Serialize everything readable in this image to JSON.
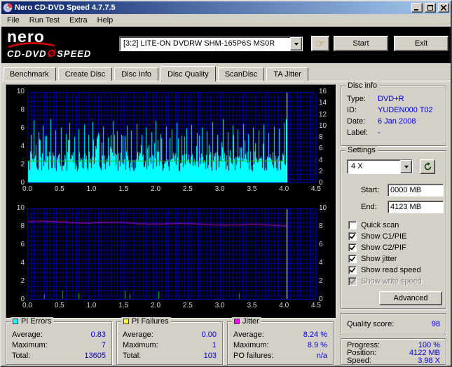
{
  "window": {
    "title": "Nero CD-DVD Speed 4.7.7.5"
  },
  "menu": {
    "items": [
      "File",
      "Run Test",
      "Extra",
      "Help"
    ]
  },
  "header": {
    "logo": {
      "brand": "nero",
      "product": "CD-DVD",
      "slash": "Ø",
      "speed": "SPEED"
    },
    "drive_select": {
      "value": "[3:2]  LITE-ON DVDRW SHM-165P6S MS0R"
    },
    "hand_icon_glyph": "☞",
    "start_button": "Start",
    "exit_button": "Exit"
  },
  "tabs": {
    "items": [
      "Benchmark",
      "Create Disc",
      "Disc Info",
      "Disc Quality",
      "ScanDisc",
      "TA Jitter"
    ],
    "active": "Disc Quality"
  },
  "disc_info": {
    "title": "Disc info",
    "rows": [
      {
        "label": "Type:",
        "value": "DVD+R"
      },
      {
        "label": "ID:",
        "value": "YUDEN000 T02"
      },
      {
        "label": "Date:",
        "value": "6 Jan 2008"
      },
      {
        "label": "Label:",
        "value": "-"
      }
    ]
  },
  "settings": {
    "title": "Settings",
    "speed_select": "4 X",
    "start_label": "Start:",
    "start_value": "0000 MB",
    "end_label": "End:",
    "end_value": "4123 MB",
    "checkboxes": [
      {
        "label": "Quick scan",
        "checked": false,
        "disabled": false
      },
      {
        "label": "Show C1/PIE",
        "checked": true,
        "disabled": false
      },
      {
        "label": "Show C2/PIF",
        "checked": true,
        "disabled": false
      },
      {
        "label": "Show jitter",
        "checked": true,
        "disabled": false
      },
      {
        "label": "Show read speed",
        "checked": true,
        "disabled": false
      },
      {
        "label": "Show write speed",
        "checked": true,
        "disabled": true
      }
    ],
    "advanced_button": "Advanced"
  },
  "quality": {
    "label": "Quality score:",
    "value": "98"
  },
  "progress": {
    "rows": [
      {
        "label": "Progress:",
        "value": "100 %"
      },
      {
        "label": "Position:",
        "value": "4122 MB"
      },
      {
        "label": "Speed:",
        "value": "3.98 X"
      }
    ]
  },
  "stats": [
    {
      "title": "PI Errors",
      "swatch": "#00FFFF",
      "rows": [
        {
          "label": "Average:",
          "value": "0.83"
        },
        {
          "label": "Maximum:",
          "value": "7"
        },
        {
          "label": "Total:",
          "value": "13605"
        }
      ]
    },
    {
      "title": "PI Failures",
      "swatch": "#FFFF00",
      "rows": [
        {
          "label": "Average:",
          "value": "0.00"
        },
        {
          "label": "Maximum:",
          "value": "1"
        },
        {
          "label": "Total:",
          "value": "103"
        }
      ]
    },
    {
      "title": "Jitter",
      "swatch": "#FF00FF",
      "rows": [
        {
          "label": "Average:",
          "value": "8.24 %"
        },
        {
          "label": "Maximum:",
          "value": "8.9 %"
        },
        {
          "label": "PO failures:",
          "value": "n/a"
        }
      ]
    }
  ],
  "chart_data": [
    {
      "type": "area",
      "title": "PI Errors (C1/PIE) with read speed line",
      "bg": "#000000",
      "grid_color": "#0000A0",
      "border_color": "#0000A0",
      "cursor_color": "#FFFFC0",
      "grid_step_x": 0.05,
      "grid_step_y": 0.5,
      "x_range": [
        0,
        4.5
      ],
      "x_ticks": [
        "0.0",
        "0.5",
        "1.0",
        "1.5",
        "2.0",
        "2.5",
        "3.0",
        "3.5",
        "4.0",
        "4.5"
      ],
      "y_left": {
        "range": [
          0,
          10
        ],
        "ticks": [
          0,
          2,
          4,
          6,
          8,
          10
        ]
      },
      "y_right": {
        "range": [
          0,
          16
        ],
        "ticks": [
          0,
          2,
          4,
          6,
          8,
          10,
          12,
          14,
          16
        ]
      },
      "data_end_x": 4.04,
      "cursor_x": 4.04,
      "summary": {
        "average": 0.83,
        "maximum": 7,
        "total": 13605
      },
      "series": [
        {
          "name": "PI Errors",
          "color": "#00FFFF",
          "style": "noise-area",
          "base": [
            1.3,
            3.5
          ],
          "spike_prob": 0.12,
          "mid_spike": [
            3.6,
            5.4
          ],
          "seed": 12345,
          "spikes": [
            [
              0.05,
              5.3
            ],
            [
              0.1,
              6.9
            ],
            [
              0.17,
              5.6
            ],
            [
              0.24,
              6.3
            ],
            [
              0.3,
              5.2
            ],
            [
              0.36,
              7.0
            ],
            [
              0.44,
              5.8
            ],
            [
              0.52,
              6.1
            ],
            [
              0.6,
              5.4
            ],
            [
              0.66,
              6.6
            ],
            [
              0.73,
              5.1
            ],
            [
              0.8,
              5.9
            ],
            [
              0.88,
              6.4
            ],
            [
              0.95,
              5.3
            ],
            [
              1.02,
              6.7
            ],
            [
              1.1,
              5.5
            ],
            [
              1.18,
              6.2
            ],
            [
              1.26,
              5.0
            ],
            [
              1.33,
              6.8
            ],
            [
              1.4,
              5.7
            ],
            [
              1.48,
              5.2
            ],
            [
              1.55,
              6.3
            ],
            [
              1.62,
              5.8
            ],
            [
              1.7,
              6.5
            ],
            [
              1.78,
              5.3
            ],
            [
              1.85,
              6.1
            ],
            [
              1.93,
              5.6
            ],
            [
              2.0,
              6.8
            ],
            [
              2.08,
              5.4
            ],
            [
              2.16,
              6.2
            ],
            [
              2.25,
              5.9
            ],
            [
              2.33,
              6.6
            ],
            [
              2.4,
              5.2
            ],
            [
              2.48,
              6.0
            ],
            [
              2.56,
              6.4
            ],
            [
              2.64,
              5.5
            ],
            [
              2.72,
              6.1
            ],
            [
              2.8,
              5.7
            ],
            [
              2.88,
              6.7
            ],
            [
              2.96,
              5.3
            ],
            [
              3.05,
              7.0
            ],
            [
              3.12,
              5.6
            ],
            [
              3.2,
              6.3
            ],
            [
              3.28,
              5.9
            ],
            [
              3.36,
              6.5
            ],
            [
              3.44,
              5.4
            ],
            [
              3.52,
              6.1
            ],
            [
              3.6,
              5.8
            ],
            [
              3.68,
              6.4
            ],
            [
              3.76,
              5.5
            ],
            [
              3.84,
              6.2
            ],
            [
              3.92,
              6.0
            ],
            [
              4.0,
              6.6
            ],
            [
              4.03,
              7.0
            ]
          ]
        },
        {
          "name": "Read speed",
          "color": "#30B430",
          "style": "hline",
          "value": 4,
          "axis": "right"
        }
      ]
    },
    {
      "type": "line",
      "title": "PI Failures (C2/PIF) and Jitter",
      "bg": "#000000",
      "grid_color": "#0000A0",
      "border_color": "#0000A0",
      "cursor_color": "#FFFFC0",
      "grid_step_x": 0.05,
      "grid_step_y": 0.5,
      "x_range": [
        0,
        4.5
      ],
      "x_ticks": [
        "0.0",
        "0.5",
        "1.0",
        "1.5",
        "2.0",
        "2.5",
        "3.0",
        "3.5",
        "4.0",
        "4.5"
      ],
      "y_left": {
        "range": [
          0,
          10
        ],
        "ticks": [
          0,
          2,
          4,
          6,
          8,
          10
        ]
      },
      "y_right": {
        "range": [
          0,
          10
        ],
        "ticks": [
          0,
          2,
          4,
          6,
          8,
          10
        ]
      },
      "data_end_x": 4.04,
      "cursor_x": 4.04,
      "summary": {
        "pif_average": 0.0,
        "pif_maximum": 1,
        "pif_total": 103,
        "jitter_average_pct": 8.24,
        "jitter_maximum_pct": 8.9
      },
      "series": [
        {
          "name": "PI Failures",
          "color": "#00C800",
          "style": "spikes",
          "spikes": [
            [
              0.26,
              0.6
            ],
            [
              0.55,
              1.0
            ],
            [
              0.8,
              0.7
            ],
            [
              1.52,
              1.0
            ],
            [
              1.6,
              0.6
            ],
            [
              2.04,
              0.9
            ],
            [
              3.3,
              0.7
            ]
          ]
        },
        {
          "name": "Jitter",
          "color": "#FF00FF",
          "style": "noisy-line",
          "start": 8.55,
          "end": 8.12,
          "noise": 0.1,
          "wave": 0.06,
          "seed": 99
        }
      ]
    }
  ]
}
